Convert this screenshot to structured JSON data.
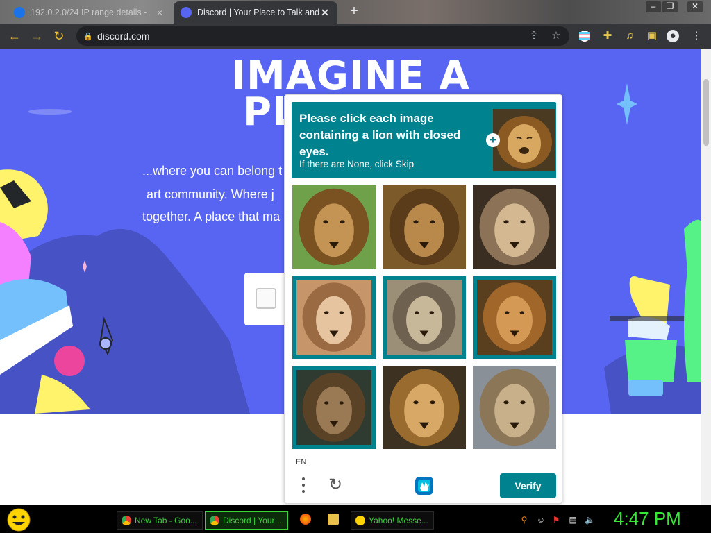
{
  "browser": {
    "tabs": [
      {
        "title": "192.0.2.0/24 IP range details - ",
        "close": "×"
      },
      {
        "title": "Discord | Your Place to Talk and H",
        "close": "✕"
      }
    ],
    "new_tab": "+",
    "url": "discord.com"
  },
  "hero": {
    "title_line1": "IMAGINE A",
    "title_line2": "PL",
    "text_line1": "...where you can belong t",
    "text_line2": "art community. Where j",
    "text_line3": "together. A place that ma"
  },
  "captcha": {
    "question": "Please click each image containing a lion with closed eyes.",
    "subtext": "If there are None, click Skip",
    "plus": "+",
    "language": "EN",
    "refresh_icon": "refresh-icon",
    "verify_label": "Verify",
    "grid": [
      {
        "selected": false
      },
      {
        "selected": false
      },
      {
        "selected": false
      },
      {
        "selected": true
      },
      {
        "selected": true
      },
      {
        "selected": true
      },
      {
        "selected": true
      },
      {
        "selected": false
      },
      {
        "selected": false
      }
    ]
  },
  "taskbar": {
    "items": [
      {
        "label": "New Tab - Goo..."
      },
      {
        "label": "Discord | Your ..."
      },
      {
        "label": "Yahoo! Messe..."
      }
    ],
    "clock": "4:47 PM"
  },
  "colors": {
    "discord_blurple": "#5865f2",
    "captcha_teal": "#00838f",
    "clock_green": "#34e834"
  }
}
